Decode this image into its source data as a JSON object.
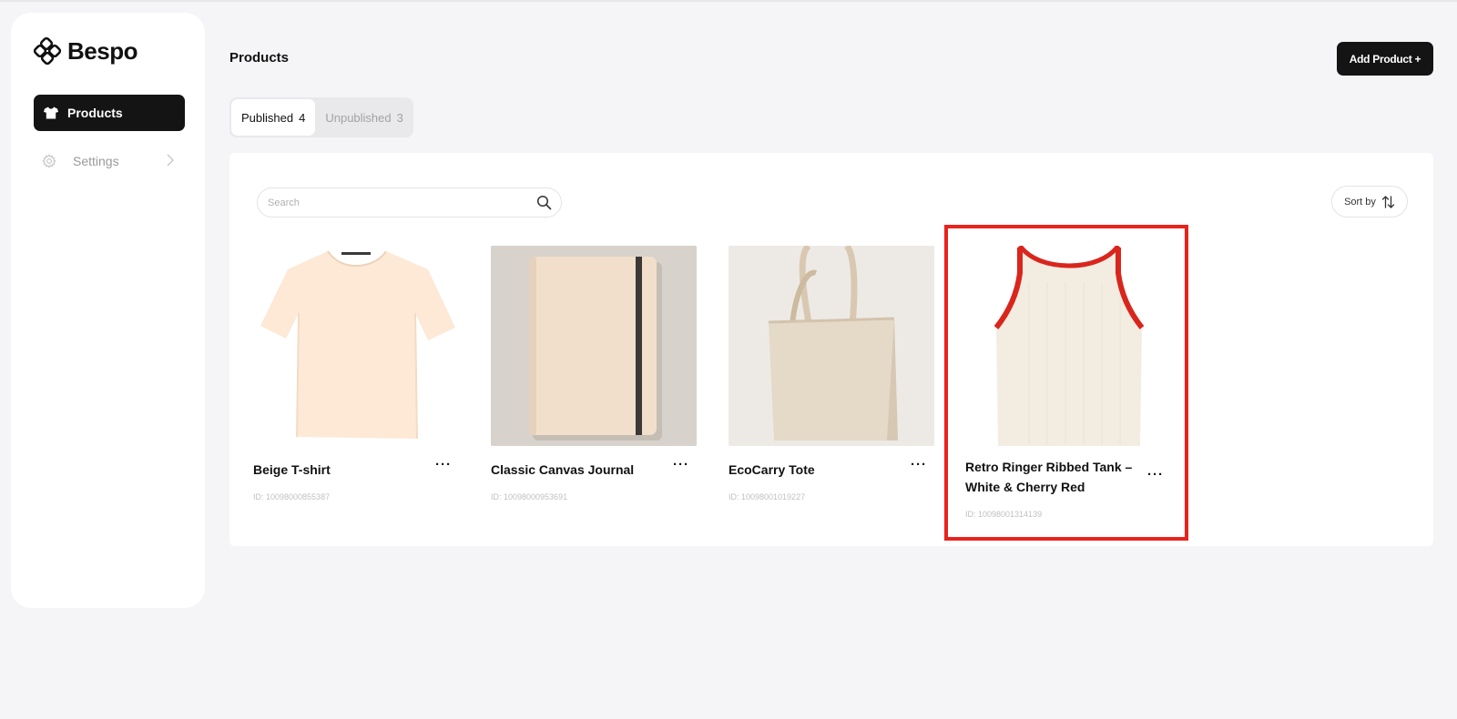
{
  "brand": {
    "name": "Bespo"
  },
  "sidebar": {
    "items": [
      {
        "label": "Products",
        "icon": "tshirt-icon",
        "active": true
      },
      {
        "label": "Settings",
        "icon": "gear-icon",
        "active": false
      }
    ]
  },
  "header": {
    "title": "Products",
    "add_button_label": "Add Product +"
  },
  "tabs": [
    {
      "label": "Published",
      "count": "4",
      "active": true
    },
    {
      "label": "Unpublished",
      "count": "3",
      "active": false
    }
  ],
  "search": {
    "placeholder": "Search",
    "value": ""
  },
  "sort": {
    "label": "Sort by"
  },
  "products": [
    {
      "name": "Beige T-shirt",
      "id": "ID: 10098000855387",
      "image": "tshirt"
    },
    {
      "name": "Classic Canvas Journal",
      "id": "ID: 10098000953691",
      "image": "journal"
    },
    {
      "name": "EcoCarry Tote",
      "id": "ID: 10098001019227",
      "image": "tote"
    },
    {
      "name": "Retro Ringer Ribbed Tank – White & Cherry Red",
      "id": "ID: 10098001314139",
      "image": "tank",
      "highlighted": true
    }
  ],
  "colors": {
    "accent_dark": "#141414",
    "highlight_border": "#e8231c",
    "tank_trim": "#d9261d",
    "background": "#f5f4f6"
  }
}
